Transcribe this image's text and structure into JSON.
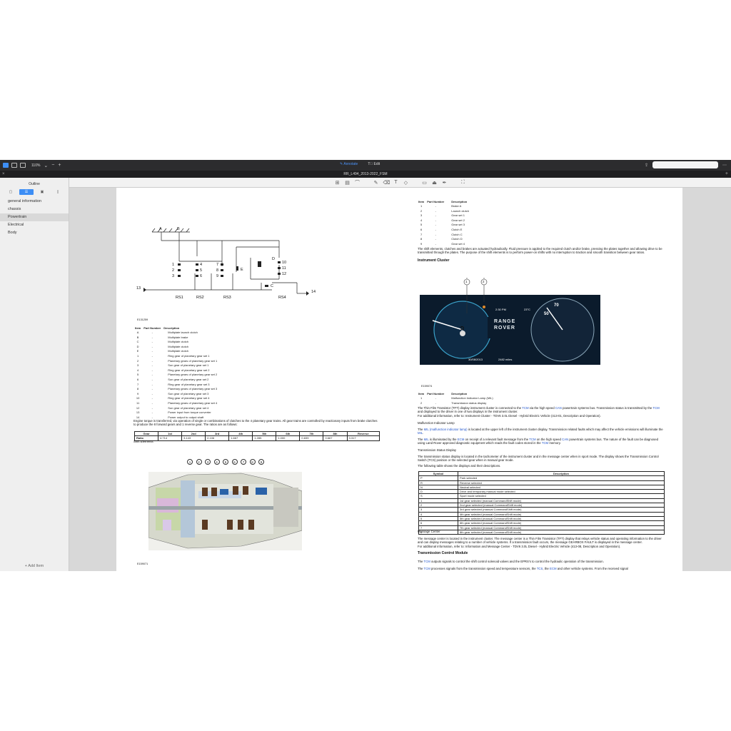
{
  "toolbar": {
    "zoom": "110%",
    "zoom_minus": "−",
    "zoom_plus": "+",
    "annotate_label": "Annotate",
    "edit_label": "Edit"
  },
  "titlebar": {
    "title": "RR_L494_2013-2022_FSM"
  },
  "sidebar": {
    "title": "Outline",
    "items": [
      "general information",
      "chassis",
      "Powertrain",
      "Electrical",
      "Body"
    ],
    "selected": "Powertrain",
    "add_item": "Add Item"
  },
  "left": {
    "diagram_labels": {
      "a": "A",
      "b": "B",
      "n1": "1",
      "n2": "2",
      "n3": "3",
      "n4": "4",
      "n5": "5",
      "n6": "6",
      "n7": "7",
      "n8": "8",
      "n9": "9",
      "n10": "10",
      "n11": "11",
      "n12": "12",
      "n13": "13",
      "n14": "14",
      "c": "C",
      "d": "D",
      "e": "E",
      "rs1": "RS1",
      "rs2": "RS2",
      "rs3": "RS3",
      "rs4": "RS4"
    },
    "fig1_ref": "E131259",
    "table_headers": [
      "Item",
      "Part Number",
      "Description"
    ],
    "rows": [
      [
        "A",
        "-",
        "Multiplate launch clutch"
      ],
      [
        "B",
        "-",
        "Multiplate brake"
      ],
      [
        "C",
        "-",
        "Multiplate clutch"
      ],
      [
        "D",
        "-",
        "Multiplate clutch"
      ],
      [
        "E",
        "-",
        "Multiplate clutch"
      ],
      [
        "1",
        "-",
        "Ring gear of planetary gear set 1"
      ],
      [
        "2",
        "-",
        "Planetary gears of planetary gear set 1"
      ],
      [
        "3",
        "-",
        "Sun gear of planetary gear set 1"
      ],
      [
        "4",
        "-",
        "Ring gear of planetary gear set 2"
      ],
      [
        "5",
        "-",
        "Planetary gears of planetary gear set 2"
      ],
      [
        "6",
        "-",
        "Sun gear of planetary gear set 2"
      ],
      [
        "7",
        "-",
        "Ring gear of planetary gear set 3"
      ],
      [
        "8",
        "-",
        "Planetary gears of planetary gear set 3"
      ],
      [
        "9",
        "-",
        "Sun gear of planetary gear set 3"
      ],
      [
        "10",
        "-",
        "Ring gear of planetary gear set 4"
      ],
      [
        "11",
        "-",
        "Planetary gears of planetary gear set 4"
      ],
      [
        "12",
        "-",
        "Sun gear of planetary gear set 4"
      ],
      [
        "13",
        "-",
        "Power input from torque converter"
      ],
      [
        "14",
        "-",
        "Power output to output shaft"
      ]
    ],
    "para": "Engine torque is transferred, via operation of single or combinations of clutches to the 4 planetary gear trains. All gear trains are controlled by reactionary inputs from brake clutches to produce the 8 forward gears and 1 reverse gear. The ratios are as follows:",
    "ratio_headers": [
      "Gear",
      "1st",
      "2nd",
      "3rd",
      "4th",
      "5th",
      "6th",
      "7th",
      "8th",
      "Reverse"
    ],
    "ratio_row": [
      "Ratio",
      "4.714",
      "3.143",
      "2.106",
      "1.667",
      "1.285",
      "1.000",
      "0.839",
      "0.667",
      "3.317"
    ],
    "shift_label": "Shift Elements",
    "callouts": [
      "1",
      "2",
      "3",
      "4",
      "5",
      "6",
      "7",
      "8",
      "9"
    ],
    "fig2_ref": "E159071"
  },
  "right": {
    "rows": [
      [
        "Item",
        "Part Number",
        "Description"
      ],
      [
        "1",
        "-",
        "Brake A"
      ],
      [
        "2",
        "-",
        "Launch clutch"
      ],
      [
        "3",
        "-",
        "Gear set 1"
      ],
      [
        "4",
        "-",
        "Gear set 2"
      ],
      [
        "5",
        "-",
        "Gear set 3"
      ],
      [
        "6",
        "-",
        "Clutch E"
      ],
      [
        "7",
        "-",
        "Clutch C"
      ],
      [
        "8",
        "-",
        "Clutch D"
      ],
      [
        "9",
        "-",
        "Gear set 4"
      ]
    ],
    "shift_para": "The shift elements, clutches and brakes are actuated hydraulically. Fluid pressure is applied to the required clutch and/or brake, pressing the plates together and allowing drive to be transmitted through the plates. The purpose of the shift elements is to perform power-on shifts with no interruption to traction and smooth transition between gear ratios.",
    "cluster_heading": "Instrument Cluster",
    "cluster": {
      "time": "2:30 PM",
      "temp": "23°C",
      "gear": "D",
      "brand1": "RANGE",
      "brand2": "ROVER",
      "date": "30/08/2013",
      "miles": "2482 miles",
      "speed_70": "70",
      "speed_50": "50",
      "callout1": "1",
      "callout2": "2"
    },
    "fig3_ref": "E159074",
    "cluster_rows": [
      [
        "Item",
        "Part Number",
        "Description"
      ],
      [
        "1",
        "-",
        "Malfunction Indicator Lamp (MIL)"
      ],
      [
        "2",
        "-",
        "Transmission status display"
      ]
    ],
    "p1_a": "The Thin Film Transistor (TFT) display instrument cluster is connected to the ",
    "p1_tcm": "TCM",
    "p1_b": " via the high speed ",
    "p1_can": "CAN",
    "p1_c": " powertrain systems bus. Transmission status is transmitted by the ",
    "p1_tcm2": "TCM",
    "p1_d": " and displayed to the driver in one of two displays in the instrument cluster.",
    "p1_ref": "For additional information, refer to: Instrument Cluster - TDV6 3.0L Diesel - Hybrid Electric Vehicle (413-01, Description and Operation).",
    "mil_heading": "Malfunction Indicator Lamp",
    "p2_a": "The ",
    "p2_mil": "MIL (malfunction indicator lamp)",
    "p2_b": " is located at the upper left of the instrument cluster display. Transmission related faults which may affect the vehicle emissions will illuminate the ",
    "p2_mil2": "MIL",
    "p2_c": ".",
    "p3_a": "The ",
    "p3_mil": "MIL",
    "p3_b": " is illuminated by the ",
    "p3_ecm": "ECM",
    "p3_c": " on receipt of a relevant fault message from the ",
    "p3_tcm": "TCM",
    "p3_d": " on the high speed ",
    "p3_can": "CAN",
    "p3_e": " powertrain systems bus. The nature of the fault can be diagnosed using Land Rover approved diagnostic equipment which reads the fault codes stored in the ",
    "p3_tcm2": "TCM",
    "p3_f": " memory.",
    "tsd_heading": "Transmission Status Display",
    "p4": "The transmission status display is located in the tachometer of the instrument cluster and in the message center when in sport mode. The display shows the Transmission Control Switch (TCS) position or the selected gear when in manual gear mode.",
    "p5": "The following table shows the displays and their descriptions.",
    "sym_headers": [
      "Symbol",
      "Description"
    ],
    "sym_rows": [
      [
        "P",
        "Park selected"
      ],
      [
        "R",
        "Reverse selected"
      ],
      [
        "N",
        "Neutral selected"
      ],
      [
        "D",
        "Drive and temporary manual mode selected"
      ],
      [
        "S",
        "Sport mode selected"
      ],
      [
        "1",
        "1st gear selected (manual CommandShift mode)"
      ],
      [
        "2",
        "2nd gear selected (manual CommandShift mode)"
      ],
      [
        "3",
        "3rd gear selected (manual CommandShift mode)"
      ],
      [
        "4",
        "4th gear selected (manual CommandShift mode)"
      ],
      [
        "5",
        "5th gear selected (manual CommandShift mode)"
      ],
      [
        "6",
        "6th gear selected (manual CommandShift mode)"
      ],
      [
        "7",
        "7th gear selected (manual CommandShift mode)"
      ],
      [
        "8",
        "8th gear selected (manual CommandShift mode)"
      ]
    ],
    "msg_heading": "Message Center",
    "p6": "The message center is located in the instrument cluster. The message center is a Thin Film Transistor (TFT) display that relays vehicle status and operating information to the driver and can display messages relating to a number of vehicle systems. If a transmission fault occurs, the message GEARBOX FAULT is displayed in the message center.",
    "p6_ref": "For additional information, refer to: Information and Message Center - TDV6 3.0L Diesel - Hybrid Electric Vehicle (413-08, Description and Operation).",
    "tcm_heading": "Transmission Control Module",
    "p7_a": "The ",
    "p7_tcm": "TCM",
    "p7_b": " outputs signals to control the shift control solenoid valves and the EPRS's to control the hydraulic operation of the transmission.",
    "p8_a": "The ",
    "p8_tcm": "TCM",
    "p8_b": " processes signals from the transmission speed and temperature sensors, the ",
    "p8_tcs": "TCS",
    "p8_c": ", the ",
    "p8_ecm": "ECM",
    "p8_d": " and other vehicle systems. From the received signal"
  }
}
